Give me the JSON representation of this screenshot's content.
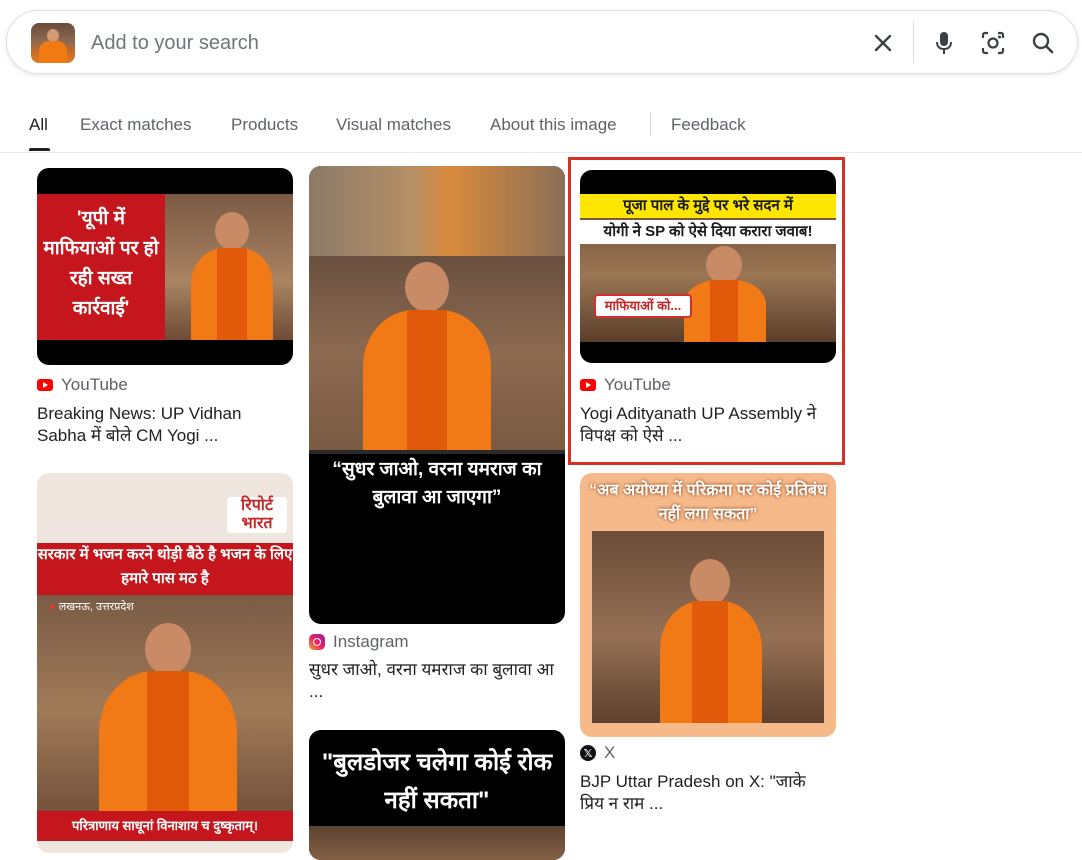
{
  "search": {
    "placeholder": "Add to your search"
  },
  "tabs": [
    {
      "label": "All",
      "active": true
    },
    {
      "label": "Exact matches"
    },
    {
      "label": "Products"
    },
    {
      "label": "Visual matches"
    },
    {
      "label": "About this image"
    },
    {
      "label": "Feedback"
    }
  ],
  "results": [
    {
      "source": "YouTube",
      "title": "Breaking News: UP Vidhan Sabha में बोले CM Yogi ...",
      "overlay": "'यूपी में माफियाओं पर हो रही सख्त कार्रवाई'"
    },
    {
      "source": "Instagram",
      "title": "सुधर जाओ, वरना यमराज का बुलावा आ ...",
      "overlay": "“सुधर जाओ, वरना यमराज का बुलावा आ जाएगा”"
    },
    {
      "source": "YouTube",
      "title": "Yogi Adityanath UP Assembly ने विपक्ष को ऐसे ...",
      "overlay_top": "पूजा पाल के मुद्दे पर भरे सदन में",
      "overlay_mid": "योगी ने SP को ऐसे दिया करारा जवाब!",
      "overlay_bubble": "माफियाओं को...",
      "highlighted": true
    },
    {
      "overlay_brand": "रिपोर्ट भारत",
      "overlay": "सरकार में भजन करने थोड़ी बैठे है भजन के लिए हमारे पास मठ है",
      "overlay_location": "लखनऊ, उत्तरप्रदेश",
      "overlay_bottom": "परित्राणाय साधूनां विनाशाय च दुष्कृताम्।"
    },
    {
      "overlay": "\"बुलडोजर चलेगा कोई रोक नहीं सकता\""
    },
    {
      "source": "X",
      "title": "BJP Uttar Pradesh on X: \"जाके प्रिय न राम ...",
      "overlay": "“अब अयोध्या में परिक्रमा पर कोई प्रतिबंध नहीं लगा सकता”"
    }
  ],
  "colors": {
    "highlight": "#d93025",
    "saffron": "#f17a16",
    "youtube": "#ff0000"
  }
}
